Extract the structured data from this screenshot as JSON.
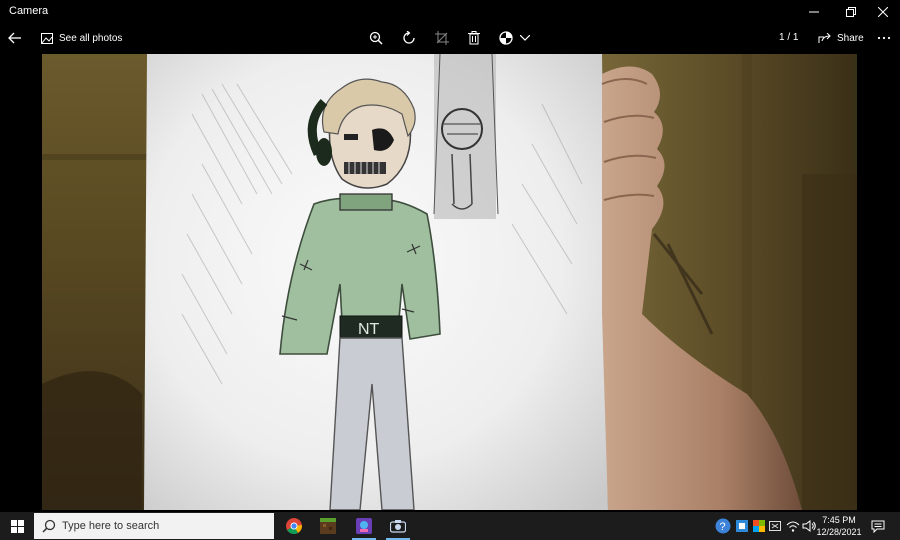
{
  "window": {
    "title": "Camera"
  },
  "commandbar": {
    "see_all_label": "See all photos",
    "counter": "1 / 1",
    "share_label": "Share"
  },
  "photo": {
    "shirt_text": "NT"
  },
  "taskbar": {
    "search_placeholder": "Type here to search",
    "time": "7:45 PM",
    "date": "12/28/2021"
  },
  "colors": {
    "accent": "#76b9ed",
    "taskbar": "#1c1c1c",
    "search_bg": "#f2f2f2"
  }
}
